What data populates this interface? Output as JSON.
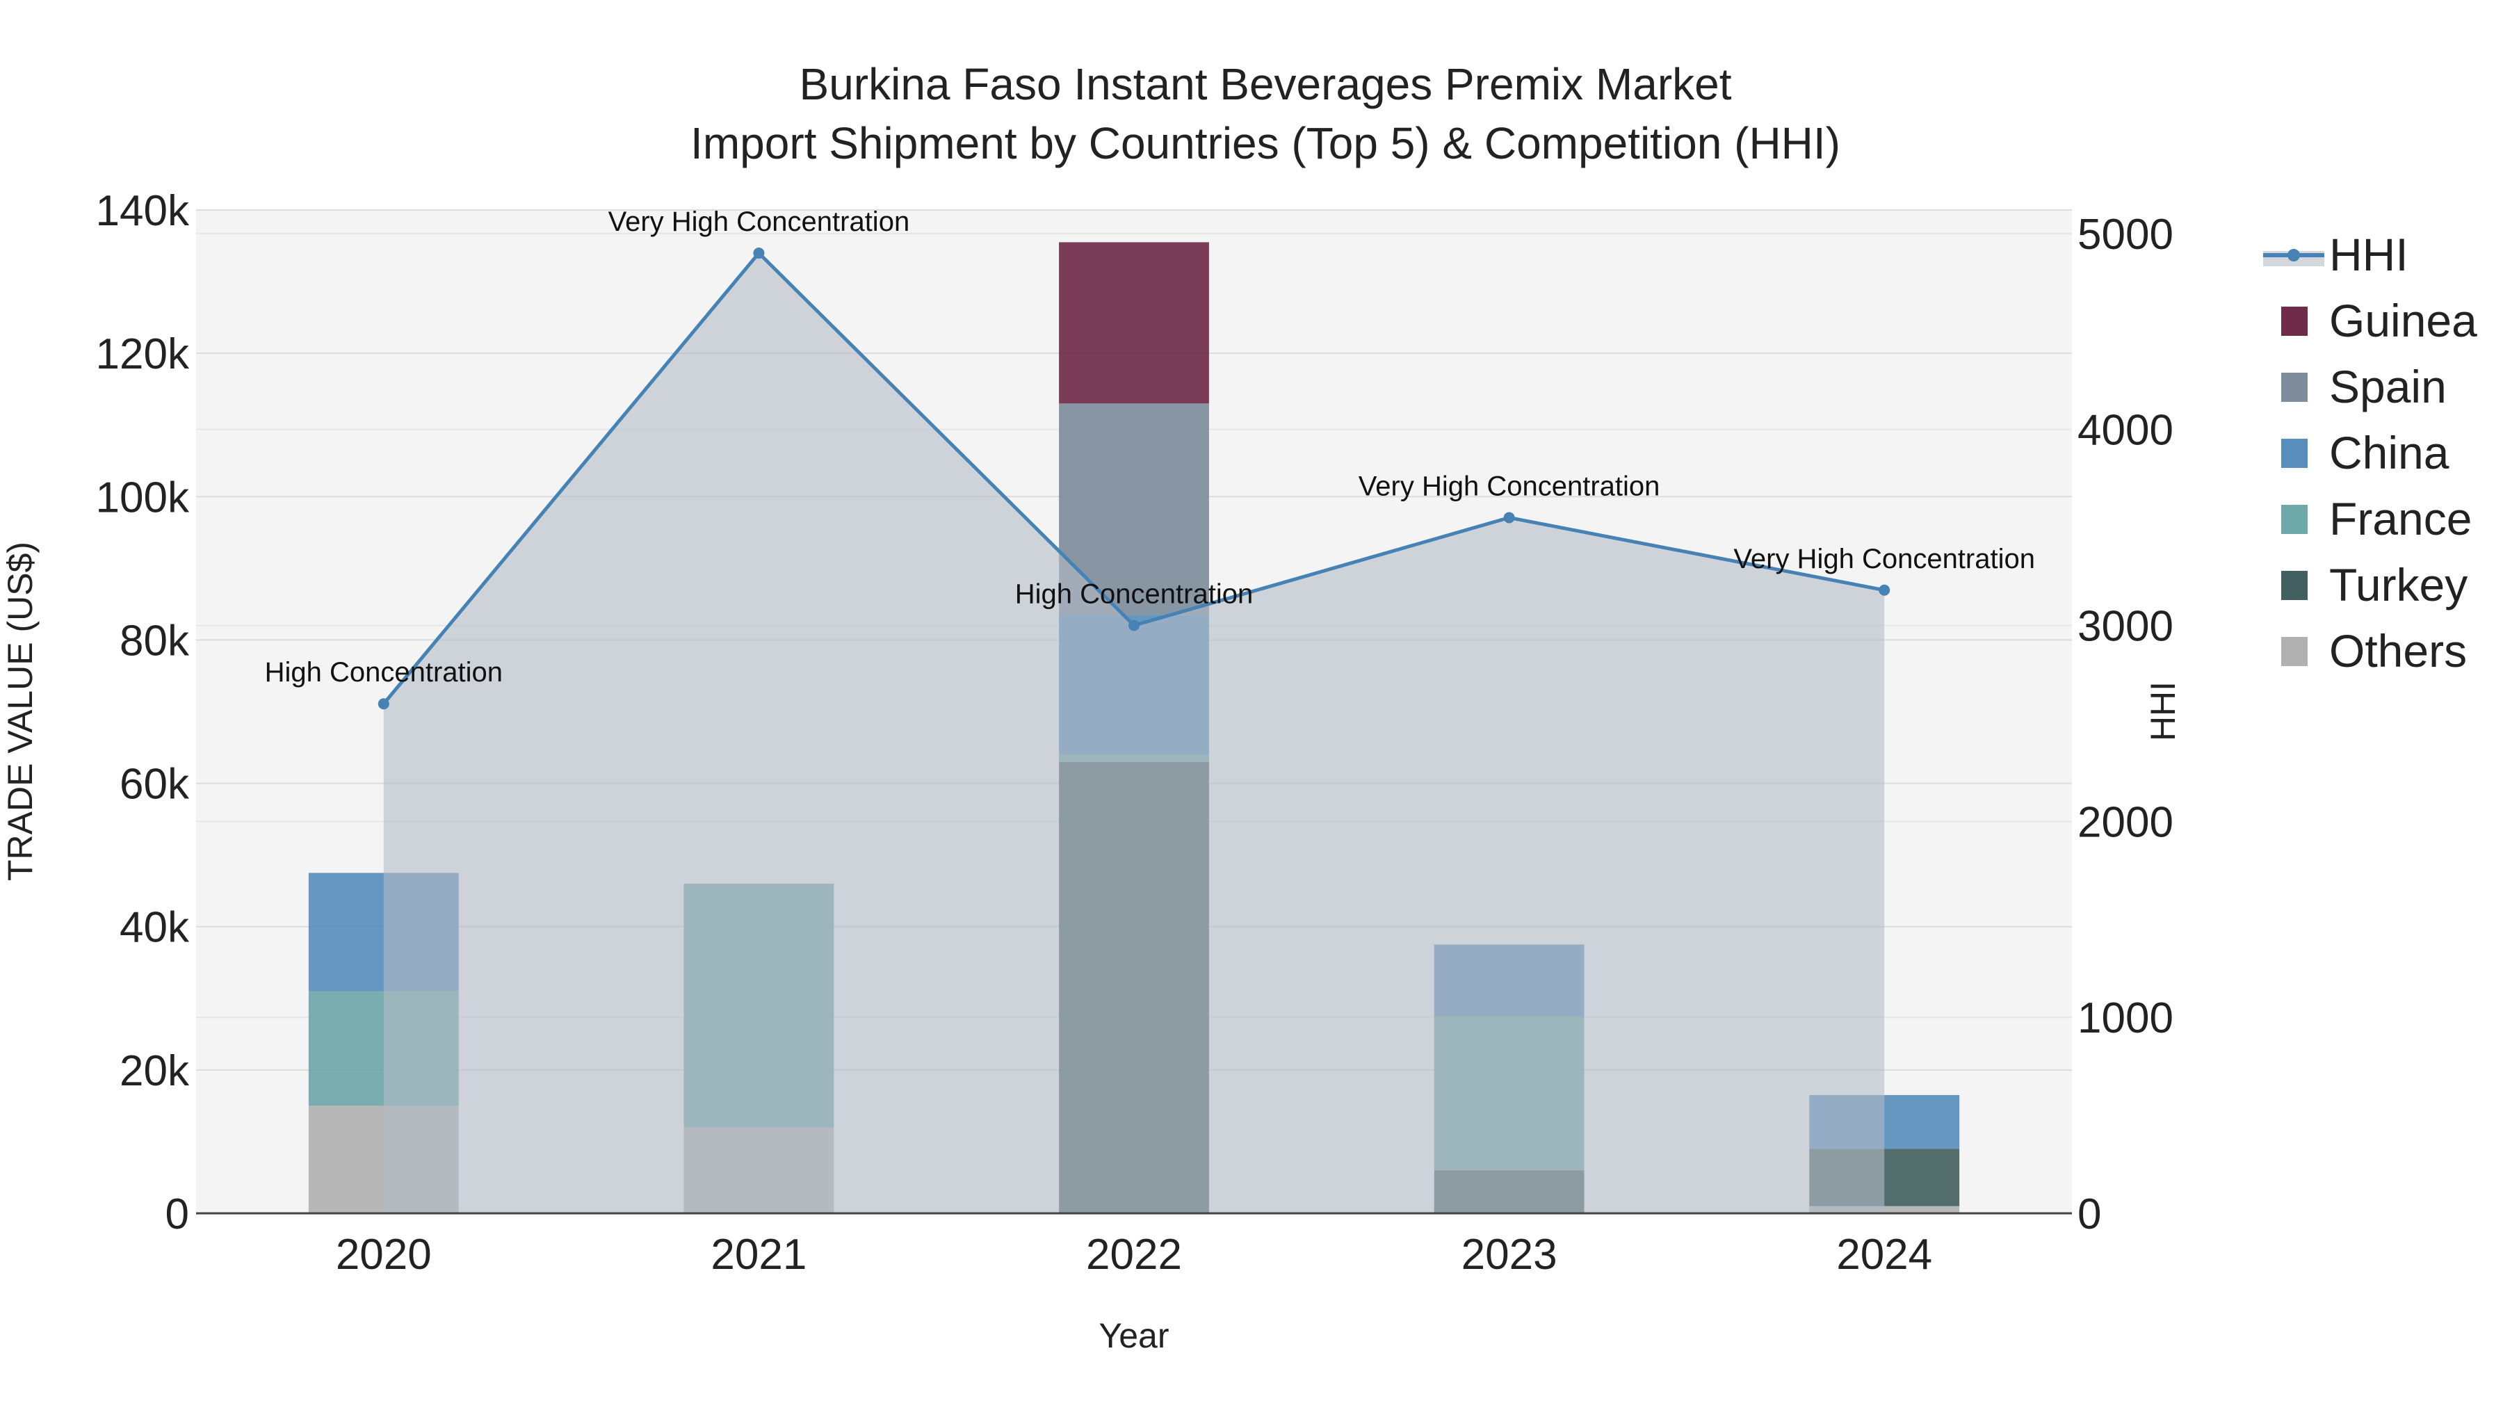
{
  "chart_data": {
    "type": "bar",
    "title": "Burkina Faso Instant Beverages Premix Market",
    "subtitle": "Import Shipment by Countries (Top 5) & Competition (HHI)",
    "xlabel": "Year",
    "ylabel": "TRADE VALUE (US$)",
    "y2label": "HHI",
    "categories": [
      "2020",
      "2021",
      "2022",
      "2023",
      "2024"
    ],
    "ylim": [
      0,
      140000
    ],
    "y2lim": [
      0,
      5120
    ],
    "yticks": [
      0,
      20000,
      40000,
      60000,
      80000,
      100000,
      120000,
      140000
    ],
    "ytick_labels": [
      "0",
      "20k",
      "40k",
      "60k",
      "80k",
      "100k",
      "120k",
      "140k"
    ],
    "y2ticks": [
      0,
      1000,
      2000,
      3000,
      4000,
      5000
    ],
    "y2tick_labels": [
      "0",
      "1000",
      "2000",
      "3000",
      "4000",
      "5000"
    ],
    "grid": true,
    "legend_position": "right",
    "stack_order": [
      "Others",
      "Turkey",
      "France",
      "China",
      "Spain",
      "Guinea"
    ],
    "series": [
      {
        "name": "Guinea",
        "color": "#5f1535",
        "values": [
          0,
          0,
          22500,
          0,
          0
        ]
      },
      {
        "name": "Spain",
        "color": "#708090",
        "values": [
          0,
          0,
          29500,
          0,
          0
        ]
      },
      {
        "name": "China",
        "color": "#4682b4",
        "values": [
          16500,
          0,
          19500,
          10000,
          7500
        ]
      },
      {
        "name": "France",
        "color": "#5f9ea0",
        "values": [
          16000,
          34000,
          1000,
          21500,
          0
        ]
      },
      {
        "name": "Turkey",
        "color": "#2f4f4f",
        "values": [
          0,
          0,
          63000,
          6000,
          8000
        ]
      },
      {
        "name": "Others",
        "color": "#a9a9a9",
        "values": [
          15000,
          12000,
          0,
          0,
          1000
        ]
      }
    ],
    "hhi": {
      "name": "HHI",
      "color": "#4682b4",
      "values": [
        2600,
        4900,
        3000,
        3550,
        3180
      ],
      "annotations": [
        "High Concentration",
        "Very High Concentration",
        "High Concentration",
        "Very High Concentration",
        "Very High Concentration"
      ]
    },
    "legend_order": [
      "HHI",
      "Guinea",
      "Spain",
      "China",
      "France",
      "Turkey",
      "Others"
    ]
  }
}
